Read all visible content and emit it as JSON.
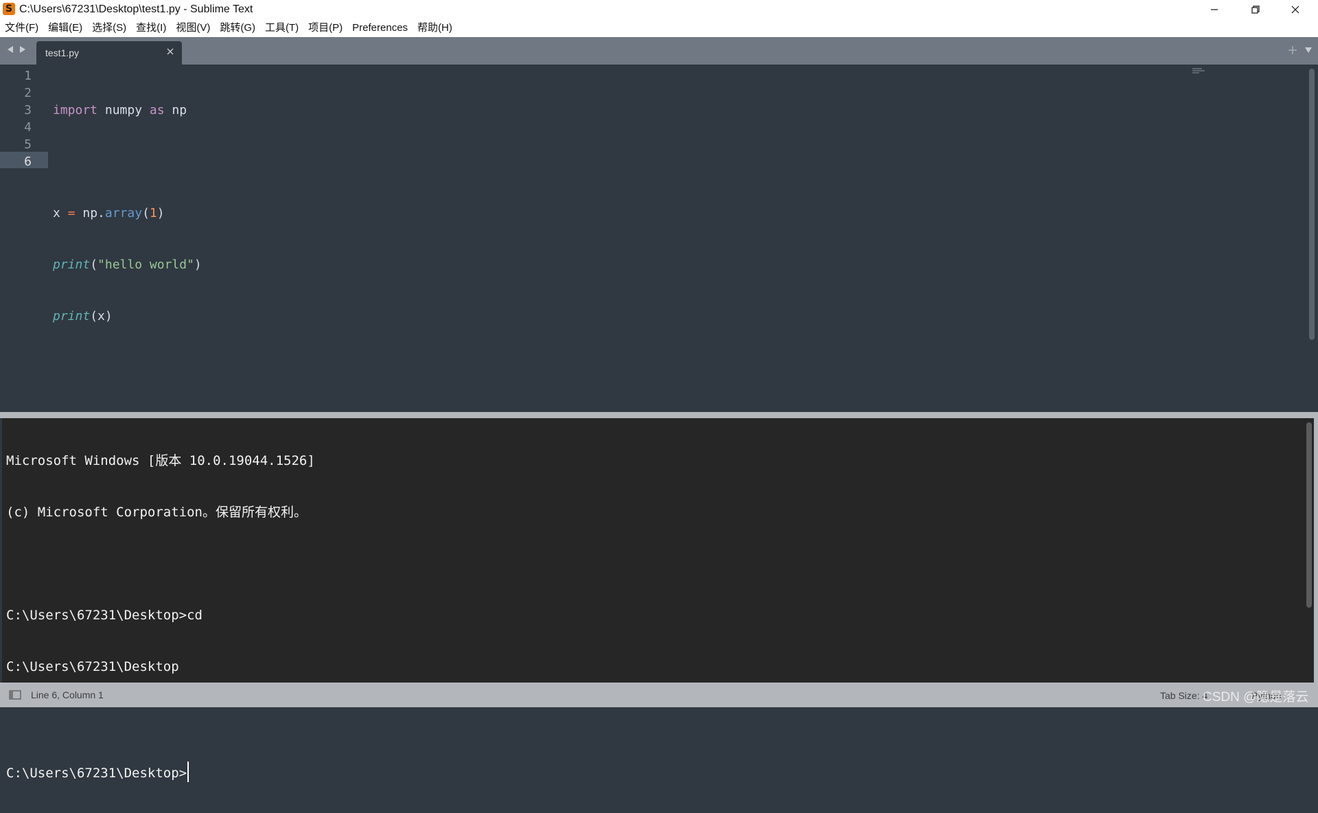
{
  "window": {
    "title": "C:\\Users\\67231\\Desktop\\test1.py - Sublime Text",
    "logo_glyph": "S",
    "icons": [
      "minimize-icon",
      "restore-icon",
      "close-icon"
    ]
  },
  "menu": {
    "items": [
      "文件(F)",
      "编辑(E)",
      "选择(S)",
      "查找(I)",
      "视图(V)",
      "跳转(G)",
      "工具(T)",
      "项目(P)",
      "Preferences",
      "帮助(H)"
    ]
  },
  "tabs": {
    "active": {
      "label": "test1.py"
    }
  },
  "editor": {
    "line_numbers": [
      "1",
      "2",
      "3",
      "4",
      "5",
      "6"
    ],
    "active_line": "6",
    "code": {
      "line1": {
        "kw": "import",
        "sp1": " numpy ",
        "as": "as",
        "sp2": " np"
      },
      "line3": {
        "a": "x ",
        "eq": "=",
        "b": " np.",
        "method": "array",
        "open": "(",
        "num": "1",
        "close": ")"
      },
      "line4": {
        "fn": "print",
        "open": "(",
        "str": "\"hello world\"",
        "close": ")"
      },
      "line5": {
        "fn": "print",
        "rest": "(x)"
      }
    }
  },
  "terminal": {
    "lines": [
      "Microsoft Windows [版本 10.0.19044.1526]",
      "(c) Microsoft Corporation。保留所有权利。",
      "",
      "C:\\Users\\67231\\Desktop>cd",
      "C:\\Users\\67231\\Desktop",
      "",
      "C:\\Users\\67231\\Desktop>"
    ]
  },
  "status": {
    "position": "Line 6, Column 1",
    "tab_size": "Tab Size: 4",
    "syntax": "Python"
  },
  "watermark": "CSDN @隐是落云",
  "colors": {
    "editor_bg": "#303841",
    "tab_bar": "#707983",
    "terminal_bg": "#262626",
    "status_bar": "#b3b7bc",
    "keyword": "#c695c6",
    "function": "#5fb4b4",
    "string": "#99c794",
    "number": "#f99157"
  }
}
